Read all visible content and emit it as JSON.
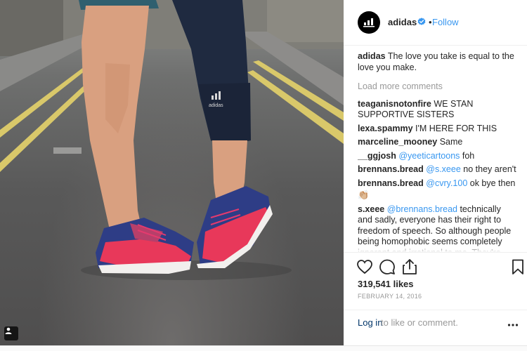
{
  "post": {
    "account": {
      "username": "adidas",
      "verified": true,
      "follow_label": "Follow",
      "separator": "•"
    },
    "caption": {
      "username": "adidas",
      "text": " The love you take is equal to the love you make."
    },
    "load_more_label": "Load more comments",
    "comments": [
      {
        "username": "teaganisnotonfire",
        "text": " WE STAN SUPPORTIVE SISTERS",
        "mention": "",
        "after": ""
      },
      {
        "username": "lexa.spammy",
        "text": " I'M HERE FOR THIS",
        "mention": "",
        "after": ""
      },
      {
        "username": "marceline_mooney",
        "text": " Same",
        "mention": "",
        "after": ""
      },
      {
        "username": "__ggjosh",
        "text": " ",
        "mention": "@yeeticartoons",
        "after": " foh"
      },
      {
        "username": "brennans.bread",
        "text": " ",
        "mention": "@s.xeee",
        "after": " no they aren't"
      },
      {
        "username": "brennans.bread",
        "text": " ",
        "mention": "@cvry.100",
        "after": " ok bye then"
      },
      {
        "username": "s.xeee",
        "text": " ",
        "mention": "@brennans.bread",
        "after": " technically and sadly, everyone has their right to freedom of speech. So although people being homophobic seems completely ignorant and irrational to me. They're allowed to voice their opinion, as long as they're not"
      }
    ],
    "emoji": "👏🏼",
    "likes": "319,541 likes",
    "date": "FEBRUARY 14, 2016",
    "login_link": "Log in",
    "login_rest": " to like or comment.",
    "photo_brand_mark": "adidas"
  },
  "icons": {
    "like": "heart-icon",
    "comment": "comment-bubble-icon",
    "share": "share-icon",
    "save": "bookmark-icon",
    "more": "more-dots-icon",
    "verified": "verified-badge-icon",
    "tagged": "profile-tag-icon"
  },
  "colors": {
    "link_blue": "#3897f0",
    "login_blue": "#003569",
    "muted": "#999999",
    "text": "#262626",
    "verified_blue": "#3897f0"
  }
}
